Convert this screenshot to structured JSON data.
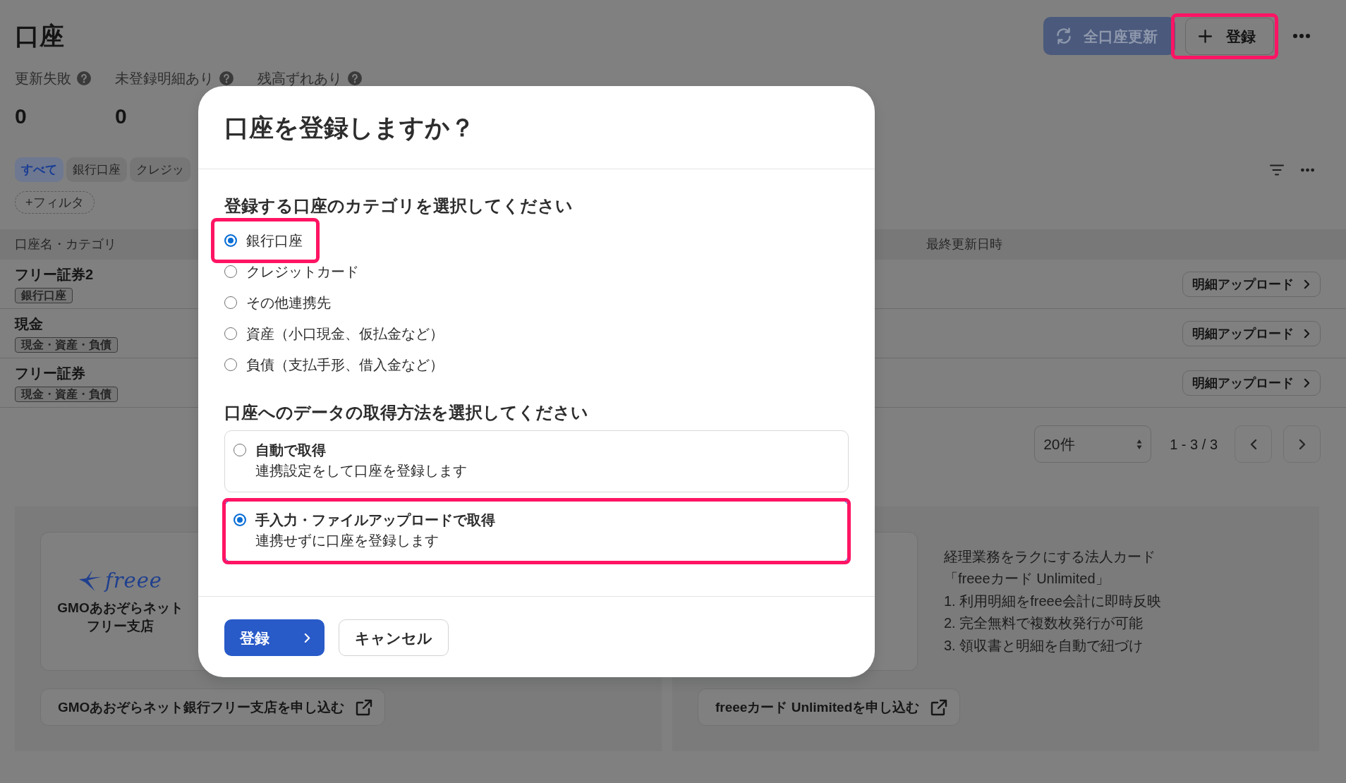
{
  "page": {
    "title": "口座",
    "toolbar": [
      {
        "kind": "refresh",
        "label": "全口座更新",
        "disabled": true,
        "highlighted": false
      },
      {
        "kind": "add",
        "label": "登録",
        "disabled": false,
        "highlighted": true
      }
    ]
  },
  "stats": [
    {
      "label": "更新失敗",
      "value": "0"
    },
    {
      "label": "未登録明細あり",
      "value": "0"
    },
    {
      "label": "残高ずれあり"
    }
  ],
  "filter_tabs": [
    {
      "label": "すべて",
      "selected": true
    },
    {
      "label": "銀行口座",
      "selected": false
    },
    {
      "label": "クレジッ",
      "selected": false
    }
  ],
  "add_filter": "+フィルタ",
  "table": {
    "columns": [
      "口座名・カテゴリ",
      "最終更新日時"
    ],
    "rows": [
      {
        "name": "フリー証券2",
        "category": "銀行口座",
        "action": "明細アップロード"
      },
      {
        "name": "現金",
        "category": "現金・資産・負債",
        "action": "明細アップロード"
      },
      {
        "name": "フリー証券",
        "category": "現金・資産・負債",
        "action": "明細アップロード"
      }
    ]
  },
  "pagination": {
    "page_size": "20件",
    "range": "1 - 3 / 3"
  },
  "promos": [
    {
      "kind": "bank",
      "logo": "freee",
      "card_lines": [
        "GMOあおぞらネット",
        "フリー支店"
      ],
      "button": "GMOあおぞらネット銀行フリー支店を申し込む"
    },
    {
      "kind": "card",
      "lines": [
        "経理業務をラクにする法人カード",
        "「freeeカード Unlimited」",
        "1. 利用明細をfreee会計に即時反映",
        "2. 完全無料で複数枚発行が可能",
        "3. 領収書と明細を自動で紐づけ"
      ],
      "button": "freeeカード Unlimitedを申し込む"
    }
  ],
  "dialog": {
    "title": "口座を登録しますか？",
    "category_heading": "登録する口座のカテゴリを選択してください",
    "categories": [
      {
        "label": "銀行口座",
        "selected": true,
        "highlighted": true
      },
      {
        "label": "クレジットカード",
        "selected": false,
        "highlighted": false
      },
      {
        "label": "その他連携先",
        "selected": false,
        "highlighted": false
      },
      {
        "label": "資産（小口現金、仮払金など）",
        "selected": false,
        "highlighted": false
      },
      {
        "label": "負債（支払手形、借入金など）",
        "selected": false,
        "highlighted": false
      }
    ],
    "method_heading": "口座へのデータの取得方法を選択してください",
    "methods": [
      {
        "label": "自動で取得",
        "description": "連携設定をして口座を登録します",
        "selected": false,
        "highlighted": false
      },
      {
        "label": "手入力・ファイルアップロードで取得",
        "description": "連携せずに口座を登録します",
        "selected": true,
        "highlighted": true
      }
    ],
    "buttons": [
      {
        "kind": "primary",
        "label": "登録"
      },
      {
        "kind": "secondary",
        "label": "キャンセル"
      }
    ]
  }
}
